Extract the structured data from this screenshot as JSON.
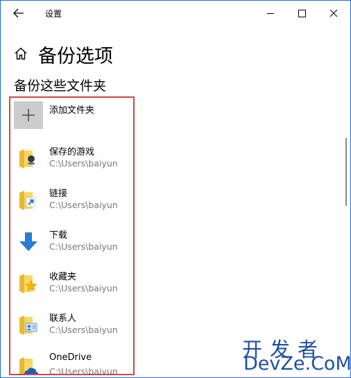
{
  "window": {
    "title": "设置"
  },
  "header": {
    "title": "备份选项"
  },
  "section": {
    "title": "备份这些文件夹"
  },
  "add_folder": {
    "label": "添加文件夹"
  },
  "folders": [
    {
      "name": "保存的游戏",
      "path": "C:\\Users\\baiyun",
      "icon": "saved-games-folder-icon"
    },
    {
      "name": "链接",
      "path": "C:\\Users\\baiyun",
      "icon": "links-folder-icon"
    },
    {
      "name": "下载",
      "path": "C:\\Users\\baiyun",
      "icon": "downloads-icon"
    },
    {
      "name": "收藏夹",
      "path": "C:\\Users\\baiyun",
      "icon": "favorites-folder-icon"
    },
    {
      "name": "联系人",
      "path": "C:\\Users\\baiyun",
      "icon": "contacts-folder-icon"
    },
    {
      "name": "OneDrive",
      "path": "C:\\Users\\baiyun",
      "icon": "onedrive-folder-icon"
    }
  ],
  "watermark": {
    "line1": "开发者",
    "line2": "DevZe.CoM"
  },
  "colors": {
    "accent": "#0078d7",
    "highlight_border": "#d64545",
    "folder_yellow": "#f4c542",
    "secondary_text": "#767676"
  }
}
